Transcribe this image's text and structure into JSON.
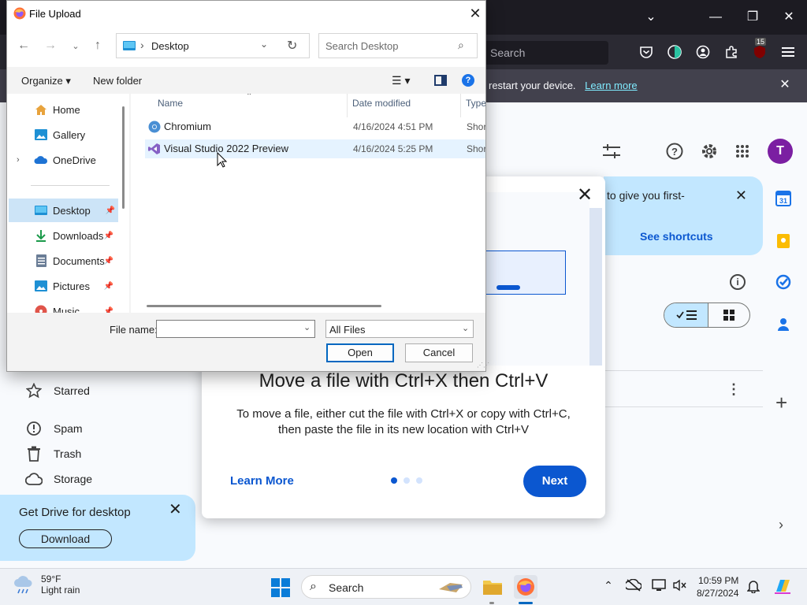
{
  "dialog": {
    "title": "File Upload",
    "address": {
      "location": "Desktop"
    },
    "search_placeholder": "Search Desktop",
    "toolbar": {
      "organize": "Organize",
      "new_folder": "New folder"
    },
    "tree": [
      {
        "label": "Home",
        "icon": "home-icon"
      },
      {
        "label": "Gallery",
        "icon": "gallery-icon"
      },
      {
        "label": "OneDrive",
        "icon": "onedrive-icon"
      },
      {
        "label": "Desktop",
        "icon": "desktop-folder-icon",
        "selected": true,
        "pinned": true
      },
      {
        "label": "Downloads",
        "icon": "downloads-icon",
        "pinned": true
      },
      {
        "label": "Documents",
        "icon": "documents-icon",
        "pinned": true
      },
      {
        "label": "Pictures",
        "icon": "pictures-icon",
        "pinned": true
      },
      {
        "label": "Music",
        "icon": "music-icon",
        "pinned": true
      }
    ],
    "columns": {
      "name": "Name",
      "date": "Date modified",
      "type": "Type"
    },
    "files": [
      {
        "name": "Chromium",
        "date": "4/16/2024 4:51 PM",
        "type": "Shortcut"
      },
      {
        "name": "Visual Studio 2022 Preview",
        "date": "4/16/2024 5:25 PM",
        "type": "Shortcut"
      }
    ],
    "file_name_label": "File name:",
    "file_name_value": "",
    "file_type_filter": "All Files",
    "open_label": "Open",
    "cancel_label": "Cancel"
  },
  "browser": {
    "search_placeholder": "Search",
    "notification": {
      "text": "restart your device.",
      "link": "Learn more"
    },
    "extension_badge": "15"
  },
  "drive": {
    "tip": {
      "text": "to give you first-",
      "shortcuts": "See shortcuts"
    },
    "avatar_letter": "T",
    "nav": [
      {
        "label": "Starred",
        "icon": "star-icon"
      },
      {
        "label": "Spam",
        "icon": "spam-icon"
      },
      {
        "label": "Trash",
        "icon": "trash-icon"
      },
      {
        "label": "Storage",
        "icon": "cloud-icon"
      }
    ],
    "get_drive": {
      "title": "Get Drive for desktop",
      "button": "Download"
    }
  },
  "modal": {
    "title": "Move a file with Ctrl+X then Ctrl+V",
    "description": "To move a file, either cut the file with Ctrl+X or copy with Ctrl+C, then paste the file in its new location with Ctrl+V",
    "learn_more": "Learn More",
    "next": "Next",
    "page_current": 1,
    "page_total": 3
  },
  "taskbar": {
    "weather": {
      "temp": "59°F",
      "desc": "Light rain"
    },
    "search_label": "Search",
    "time": "10:59 PM",
    "date": "8/27/2024"
  },
  "colors": {
    "accent": "#0b57d0",
    "banner": "#c2e7ff",
    "firefox_dark": "#2b2a33"
  }
}
